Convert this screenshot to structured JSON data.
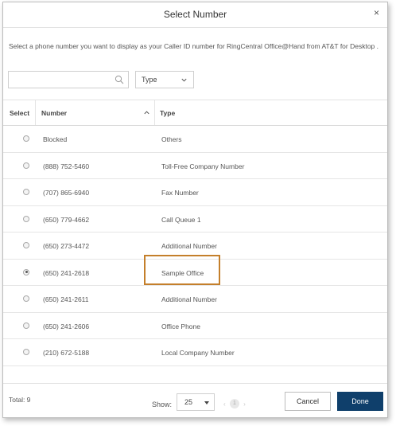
{
  "dialog": {
    "title": "Select Number",
    "close_glyph": "×",
    "description": "Select a phone number you want to display as your Caller ID number for RingCentral Office@Hand from AT&T for Desktop ."
  },
  "filters": {
    "search_placeholder": "",
    "search_value": "",
    "type_label": "Type"
  },
  "table": {
    "headers": {
      "select": "Select",
      "number": "Number",
      "type": "Type"
    },
    "rows": [
      {
        "number": "Blocked",
        "type": "Others",
        "selected": false
      },
      {
        "number": "(888) 752-5460",
        "type": "Toll-Free Company Number",
        "selected": false
      },
      {
        "number": "(707) 865-6940",
        "type": "Fax Number",
        "selected": false
      },
      {
        "number": "(650) 779-4662",
        "type": "Call Queue 1",
        "selected": false
      },
      {
        "number": "(650) 273-4472",
        "type": "Additional Number",
        "selected": false
      },
      {
        "number": "(650) 241-2618",
        "type": "Sample Office",
        "selected": true
      },
      {
        "number": "(650) 241-2611",
        "type": "Additional Number",
        "selected": false
      },
      {
        "number": "(650) 241-2606",
        "type": "Office Phone",
        "selected": false
      },
      {
        "number": "(210) 672-5188",
        "type": "Local Company Number",
        "selected": false
      }
    ]
  },
  "footer": {
    "total": "Total: 9",
    "show_label": "Show:",
    "page_size": "25",
    "pager": {
      "prev": "‹",
      "page": "1",
      "next": "›"
    },
    "cancel_label": "Cancel",
    "done_label": "Done"
  },
  "colors": {
    "done_button": "#0f3f6b",
    "highlight_border": "#c47f2b"
  },
  "icons": [
    "close-icon",
    "search-icon",
    "chevron-down-icon",
    "sort-ascending-icon"
  ]
}
